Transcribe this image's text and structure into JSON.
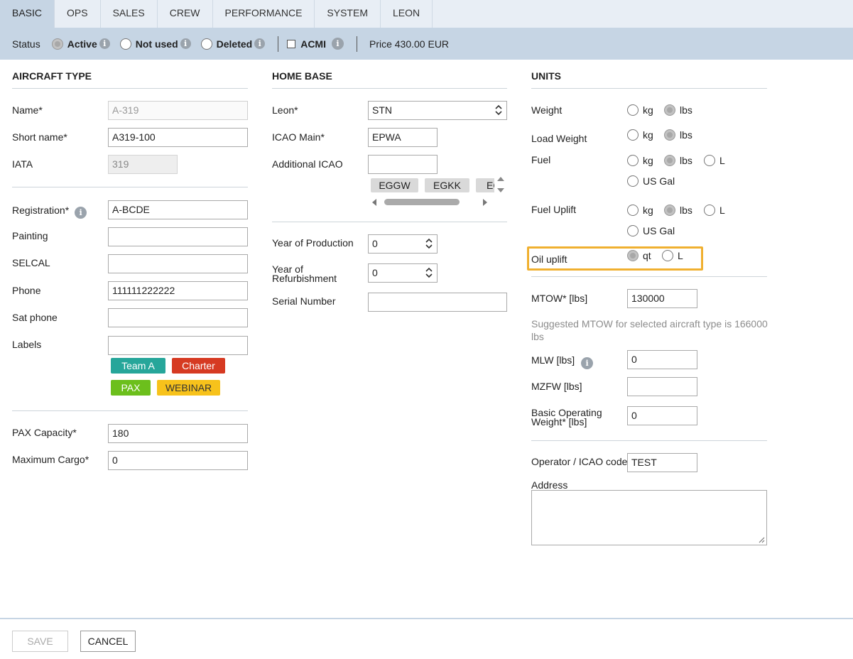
{
  "tabs": [
    "BASIC",
    "OPS",
    "SALES",
    "CREW",
    "PERFORMANCE",
    "SYSTEM",
    "LEON"
  ],
  "status": {
    "label": "Status",
    "options": [
      {
        "label": "Active",
        "selected": true
      },
      {
        "label": "Not used",
        "selected": false
      },
      {
        "label": "Deleted",
        "selected": false
      }
    ],
    "acmi_label": "ACMI",
    "acmi_checked": false,
    "price": "Price 430.00 EUR"
  },
  "aircraft_type": {
    "title": "AIRCRAFT TYPE",
    "name_label": "Name*",
    "name_value": "A-319",
    "short_name_label": "Short name*",
    "short_name_value": "A319-100",
    "iata_label": "IATA",
    "iata_value": "319"
  },
  "registration_block": {
    "registration_label": "Registration*",
    "registration_value": "A-BCDE",
    "painting_label": "Painting",
    "painting_value": "",
    "selcal_label": "SELCAL",
    "selcal_value": "",
    "phone_label": "Phone",
    "phone_value": "111111222222",
    "sat_phone_label": "Sat phone",
    "sat_phone_value": "",
    "labels_label": "Labels",
    "labels_value": "",
    "tags": [
      {
        "text": "Team A",
        "color": "#26a69a"
      },
      {
        "text": "Charter",
        "color": "#d63a22"
      },
      {
        "text": "PAX",
        "color": "#6cbf1c"
      },
      {
        "text": "WEBINAR",
        "color": "#f7c21b"
      }
    ]
  },
  "capacity": {
    "pax_label": "PAX Capacity*",
    "pax_value": "180",
    "cargo_label": "Maximum Cargo*",
    "cargo_value": "0"
  },
  "home_base": {
    "title": "HOME BASE",
    "leon_label": "Leon*",
    "leon_value": "STN",
    "icao_main_label": "ICAO Main*",
    "icao_main_value": "EPWA",
    "additional_icao_label": "Additional ICAO",
    "additional_icao_value": "",
    "additional_chips": [
      "EGGW",
      "EGKK",
      "EG"
    ],
    "year_production_label": "Year of Production",
    "year_production_value": "0",
    "year_refurb_label_1": "Year of",
    "year_refurb_label_2": "Refurbishment",
    "year_refurb_value": "0",
    "serial_label": "Serial Number",
    "serial_value": ""
  },
  "units": {
    "title": "UNITS",
    "weight_label": "Weight",
    "load_weight_label": "Load Weight",
    "fuel_label": "Fuel",
    "fuel_uplift_label": "Fuel Uplift",
    "oil_uplift_label": "Oil uplift",
    "opt_kg": "kg",
    "opt_lbs": "lbs",
    "opt_l": "L",
    "opt_usgal": "US Gal",
    "opt_qt": "qt",
    "highlight_color": "#f0b030"
  },
  "weights": {
    "mtow_label": "MTOW* [lbs]",
    "mtow_value": "130000",
    "suggested_1": "Suggested MTOW for selected aircraft type is 166000",
    "suggested_2": "lbs",
    "mlw_label": "MLW [lbs]",
    "mlw_value": "0",
    "mzfw_label": "MZFW [lbs]",
    "mzfw_value": "",
    "bow_label_1": "Basic Operating",
    "bow_label_2": "Weight* [lbs]",
    "bow_value": "0"
  },
  "operator": {
    "code_label": "Operator / ICAO code",
    "code_value": "TEST",
    "address_label": "Address",
    "address_value": ""
  },
  "footer": {
    "save": "SAVE",
    "cancel": "CANCEL"
  }
}
